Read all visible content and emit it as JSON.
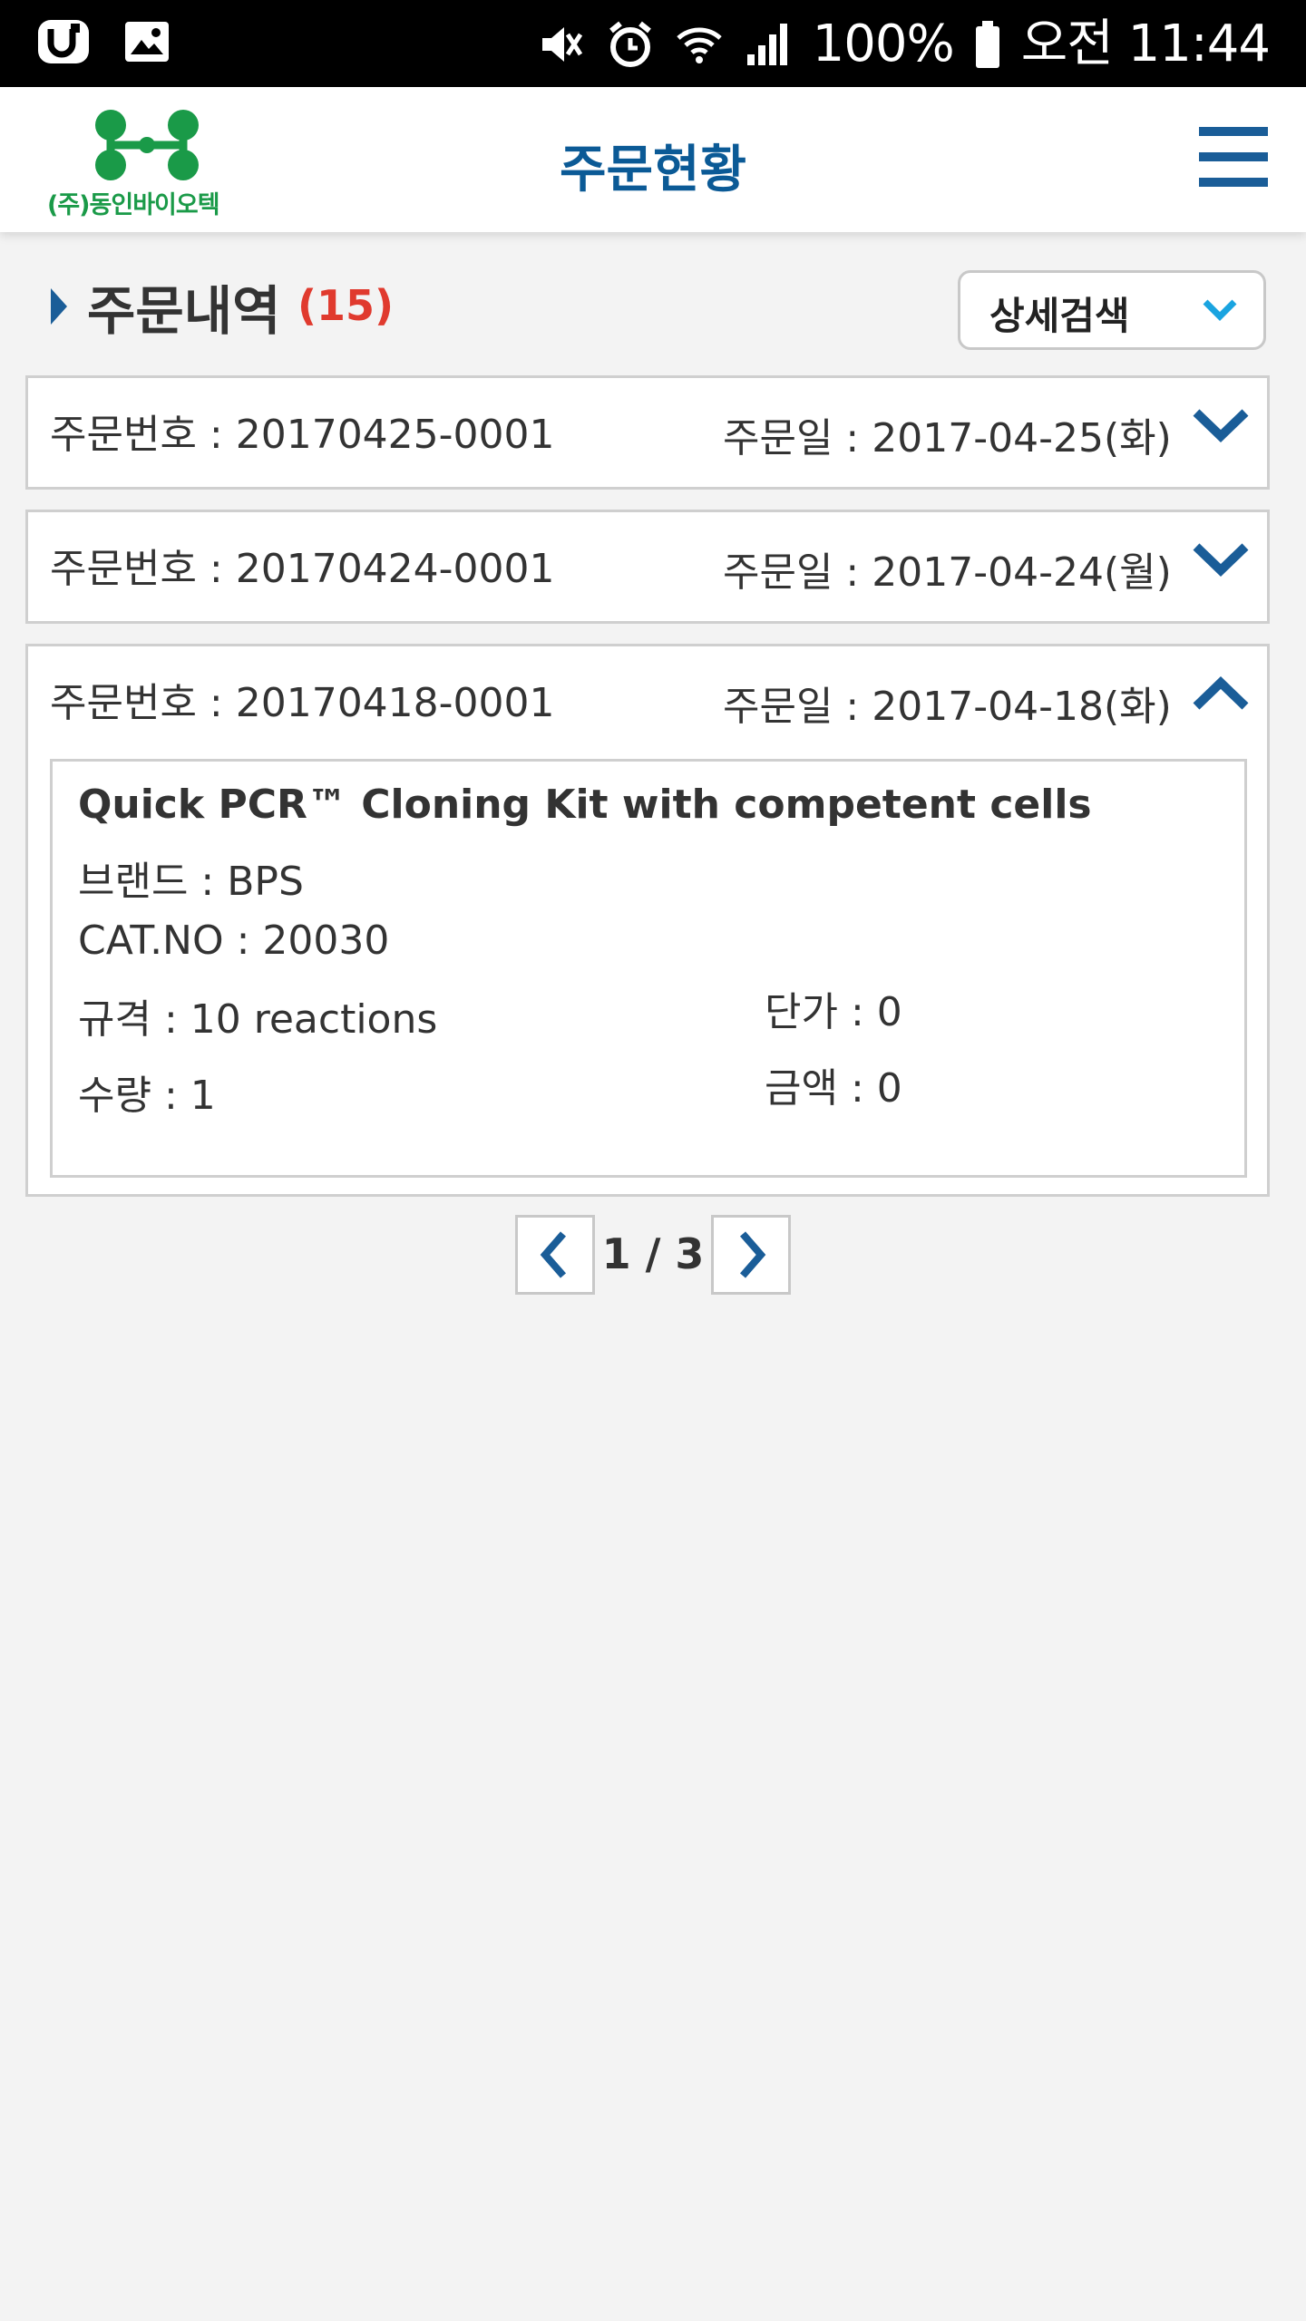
{
  "status_bar": {
    "left_icons": [
      "u-plus-icon",
      "image-icon"
    ],
    "right_icons": [
      "mute-icon",
      "alarm-icon",
      "wifi-icon",
      "signal-icon"
    ],
    "battery": "100%",
    "time": "오전 11:44"
  },
  "header": {
    "logo_text": "(주)동인바이오텍",
    "title": "주문현황",
    "menu_icon": "hamburger-menu-icon"
  },
  "section": {
    "title": "주문내역",
    "count": "(15)",
    "detail_search_label": "상세검색"
  },
  "orders": [
    {
      "order_no": "주문번호 : 20170425-0001",
      "order_date": "주문일 : 2017-04-25(화)",
      "expanded": false
    },
    {
      "order_no": "주문번호 : 20170424-0001",
      "order_date": "주문일 : 2017-04-24(월)",
      "expanded": false
    },
    {
      "order_no": "주문번호 : 20170418-0001",
      "order_date": "주문일 : 2017-04-18(화)",
      "expanded": true,
      "item": {
        "name": "Quick PCR™ Cloning Kit with competent cells",
        "brand": "브랜드 : BPS",
        "cat_no": "CAT.NO : 20030",
        "spec": "규격 : 10 reactions",
        "quantity": "수량 : 1",
        "unit_price": "단가 : 0",
        "amount": "금액 : 0"
      }
    }
  ],
  "pagination": {
    "text": "1 / 3"
  },
  "colors": {
    "accent_blue": "#1a5d98",
    "title_blue": "#0b5a96",
    "count_red": "#e03a2e",
    "logo_green": "#1a9a48"
  }
}
